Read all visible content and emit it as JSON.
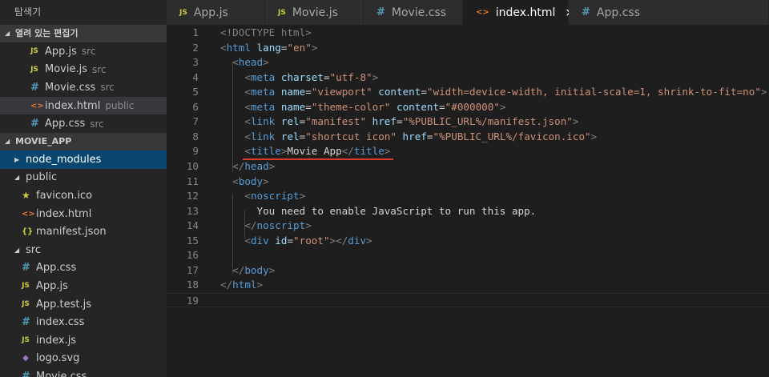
{
  "sidebar": {
    "title": "탐색기",
    "open_editors": {
      "header": "열려 있는 편집기",
      "items": [
        {
          "icon": "JS",
          "label": "App.js",
          "desc": "src"
        },
        {
          "icon": "JS",
          "label": "Movie.js",
          "desc": "src"
        },
        {
          "icon": "#",
          "label": "Movie.css",
          "desc": "src"
        },
        {
          "icon": "<>",
          "label": "index.html",
          "desc": "public"
        },
        {
          "icon": "#",
          "label": "App.css",
          "desc": "src"
        }
      ]
    },
    "project": {
      "header": "MOVIE_APP",
      "items": [
        {
          "label": "node_modules"
        },
        {
          "label": "public"
        },
        {
          "icon": "★",
          "label": "favicon.ico"
        },
        {
          "icon": "<>",
          "label": "index.html"
        },
        {
          "icon": "{}",
          "label": "manifest.json"
        },
        {
          "label": "src"
        },
        {
          "icon": "#",
          "label": "App.css"
        },
        {
          "icon": "JS",
          "label": "App.js"
        },
        {
          "icon": "JS",
          "label": "App.test.js"
        },
        {
          "icon": "#",
          "label": "index.css"
        },
        {
          "icon": "JS",
          "label": "index.js"
        },
        {
          "icon": "◆",
          "label": "logo.svg"
        },
        {
          "icon": "#",
          "label": "Movie.css"
        }
      ]
    }
  },
  "tabs": [
    {
      "icon": "JS",
      "label": "App.js"
    },
    {
      "icon": "JS",
      "label": "Movie.js"
    },
    {
      "icon": "#",
      "label": "Movie.css"
    },
    {
      "icon": "<>",
      "label": "index.html",
      "close": "×"
    },
    {
      "icon": "#",
      "label": "App.css"
    }
  ],
  "editor": {
    "line_numbers": [
      "1",
      "2",
      "3",
      "4",
      "5",
      "6",
      "7",
      "8",
      "9",
      "10",
      "11",
      "12",
      "13",
      "14",
      "15",
      "16",
      "17",
      "18",
      "19"
    ],
    "lines": [
      [
        [
          "punct",
          "<!DOCTYPE html>"
        ]
      ],
      [
        [
          "punct",
          "<"
        ],
        [
          "tag",
          "html"
        ],
        [
          "text",
          " "
        ],
        [
          "attr",
          "lang"
        ],
        [
          "text",
          "="
        ],
        [
          "str",
          "\"en\""
        ],
        [
          "punct",
          ">"
        ]
      ],
      [
        [
          "text",
          "  "
        ],
        [
          "punct",
          "<"
        ],
        [
          "tag",
          "head"
        ],
        [
          "punct",
          ">"
        ]
      ],
      [
        [
          "text",
          "    "
        ],
        [
          "punct",
          "<"
        ],
        [
          "tag",
          "meta"
        ],
        [
          "text",
          " "
        ],
        [
          "attr",
          "charset"
        ],
        [
          "text",
          "="
        ],
        [
          "str",
          "\"utf-8\""
        ],
        [
          "punct",
          ">"
        ]
      ],
      [
        [
          "text",
          "    "
        ],
        [
          "punct",
          "<"
        ],
        [
          "tag",
          "meta"
        ],
        [
          "text",
          " "
        ],
        [
          "attr",
          "name"
        ],
        [
          "text",
          "="
        ],
        [
          "str",
          "\"viewport\""
        ],
        [
          "text",
          " "
        ],
        [
          "attr",
          "content"
        ],
        [
          "text",
          "="
        ],
        [
          "str",
          "\"width=device-width, initial-scale=1, shrink-to-fit=no\""
        ],
        [
          "punct",
          ">"
        ]
      ],
      [
        [
          "text",
          "    "
        ],
        [
          "punct",
          "<"
        ],
        [
          "tag",
          "meta"
        ],
        [
          "text",
          " "
        ],
        [
          "attr",
          "name"
        ],
        [
          "text",
          "="
        ],
        [
          "str",
          "\"theme-color\""
        ],
        [
          "text",
          " "
        ],
        [
          "attr",
          "content"
        ],
        [
          "text",
          "="
        ],
        [
          "str",
          "\"#000000\""
        ],
        [
          "punct",
          ">"
        ]
      ],
      [
        [
          "text",
          "    "
        ],
        [
          "punct",
          "<"
        ],
        [
          "tag",
          "link"
        ],
        [
          "text",
          " "
        ],
        [
          "attr",
          "rel"
        ],
        [
          "text",
          "="
        ],
        [
          "str",
          "\"manifest\""
        ],
        [
          "text",
          " "
        ],
        [
          "attr",
          "href"
        ],
        [
          "text",
          "="
        ],
        [
          "str",
          "\"%PUBLIC_URL%/manifest.json\""
        ],
        [
          "punct",
          ">"
        ]
      ],
      [
        [
          "text",
          "    "
        ],
        [
          "punct",
          "<"
        ],
        [
          "tag",
          "link"
        ],
        [
          "text",
          " "
        ],
        [
          "attr",
          "rel"
        ],
        [
          "text",
          "="
        ],
        [
          "str",
          "\"shortcut icon\""
        ],
        [
          "text",
          " "
        ],
        [
          "attr",
          "href"
        ],
        [
          "text",
          "="
        ],
        [
          "str",
          "\"%PUBLIC_URL%/favicon.ico\""
        ],
        [
          "punct",
          ">"
        ]
      ],
      [
        [
          "text",
          "    "
        ],
        [
          "punct",
          "<"
        ],
        [
          "tag",
          "title"
        ],
        [
          "punct",
          ">"
        ],
        [
          "text",
          "Movie App"
        ],
        [
          "punct",
          "</"
        ],
        [
          "tag",
          "title"
        ],
        [
          "punct",
          ">"
        ]
      ],
      [
        [
          "text",
          "  "
        ],
        [
          "punct",
          "</"
        ],
        [
          "tag",
          "head"
        ],
        [
          "punct",
          ">"
        ]
      ],
      [
        [
          "text",
          "  "
        ],
        [
          "punct",
          "<"
        ],
        [
          "tag",
          "body"
        ],
        [
          "punct",
          ">"
        ]
      ],
      [
        [
          "text",
          "    "
        ],
        [
          "punct",
          "<"
        ],
        [
          "tag",
          "noscript"
        ],
        [
          "punct",
          ">"
        ]
      ],
      [
        [
          "text",
          "      You need to enable JavaScript to run this app."
        ]
      ],
      [
        [
          "text",
          "    "
        ],
        [
          "punct",
          "</"
        ],
        [
          "tag",
          "noscript"
        ],
        [
          "punct",
          ">"
        ]
      ],
      [
        [
          "text",
          "    "
        ],
        [
          "punct",
          "<"
        ],
        [
          "tag",
          "div"
        ],
        [
          "text",
          " "
        ],
        [
          "attr",
          "id"
        ],
        [
          "text",
          "="
        ],
        [
          "str",
          "\"root\""
        ],
        [
          "punct",
          "></"
        ],
        [
          "tag",
          "div"
        ],
        [
          "punct",
          ">"
        ]
      ],
      [],
      [
        [
          "text",
          "  "
        ],
        [
          "punct",
          "</"
        ],
        [
          "tag",
          "body"
        ],
        [
          "punct",
          ">"
        ]
      ],
      [
        [
          "punct",
          "</"
        ],
        [
          "tag",
          "html"
        ],
        [
          "punct",
          ">"
        ]
      ],
      []
    ]
  }
}
